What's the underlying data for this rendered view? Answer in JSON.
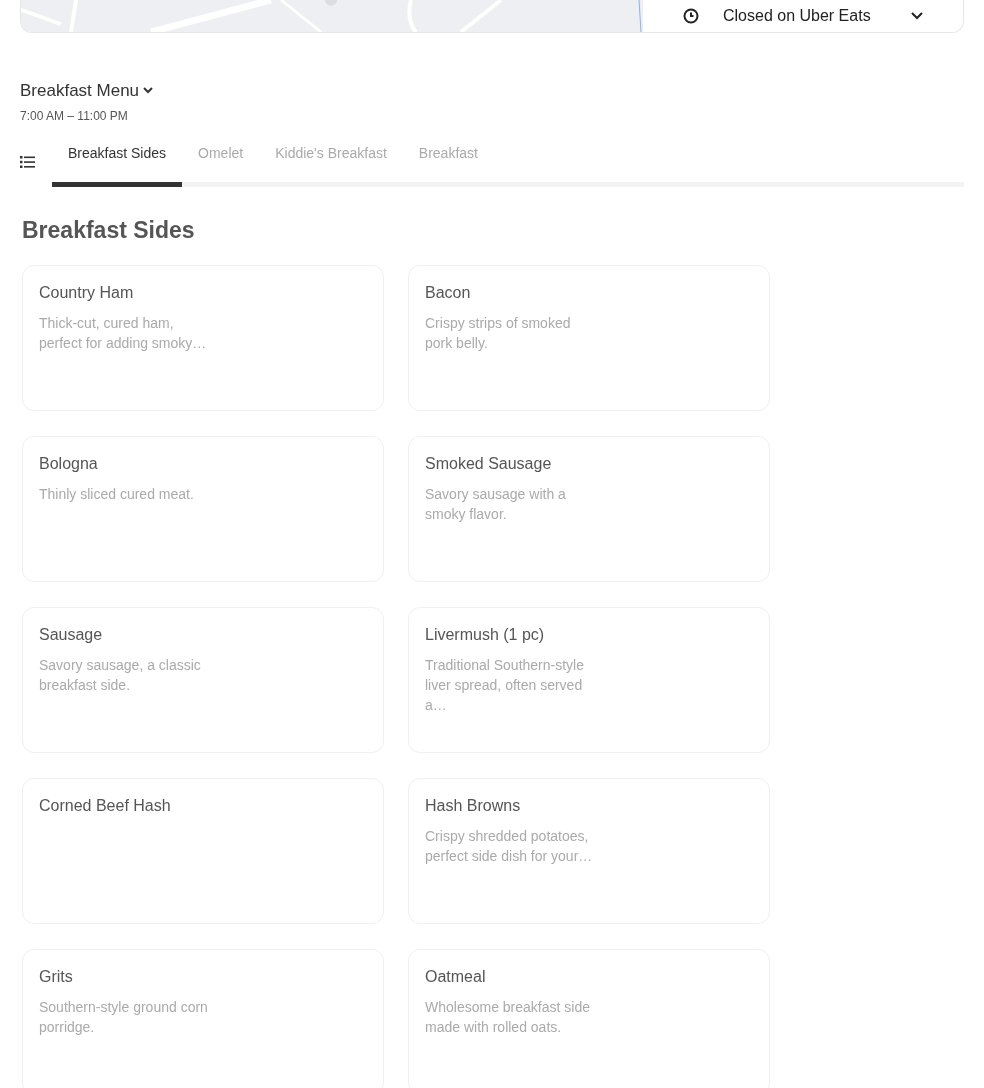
{
  "store_status": {
    "label": "Closed on Uber Eats"
  },
  "menu": {
    "title": "Breakfast Menu",
    "hours": "7:00 AM – 11:00 PM"
  },
  "tabs": [
    {
      "label": "Breakfast Sides",
      "selected": true
    },
    {
      "label": "Omelet",
      "selected": false
    },
    {
      "label": "Kiddie's Breakfast",
      "selected": false
    },
    {
      "label": "Breakfast",
      "selected": false
    }
  ],
  "section": {
    "title": "Breakfast Sides"
  },
  "items": [
    {
      "name": "Country Ham",
      "description": "Thick-cut, cured ham, perfect for adding smoky…"
    },
    {
      "name": "Bacon",
      "description": "Crispy strips of smoked pork belly."
    },
    {
      "name": "Bologna",
      "description": "Thinly sliced cured meat."
    },
    {
      "name": "Smoked Sausage",
      "description": "Savory sausage with a smoky flavor."
    },
    {
      "name": "Sausage",
      "description": "Savory sausage, a classic breakfast side."
    },
    {
      "name": "Livermush (1 pc)",
      "description": "Traditional Southern-style liver spread, often served a…"
    },
    {
      "name": "Corned Beef Hash"
    },
    {
      "name": "Hash Browns",
      "description": "Crispy shredded potatoes, perfect side dish for your…"
    },
    {
      "name": "Grits",
      "description": "Southern-style ground corn porridge."
    },
    {
      "name": "Oatmeal",
      "description": "Wholesome breakfast side made with rolled oats."
    }
  ]
}
